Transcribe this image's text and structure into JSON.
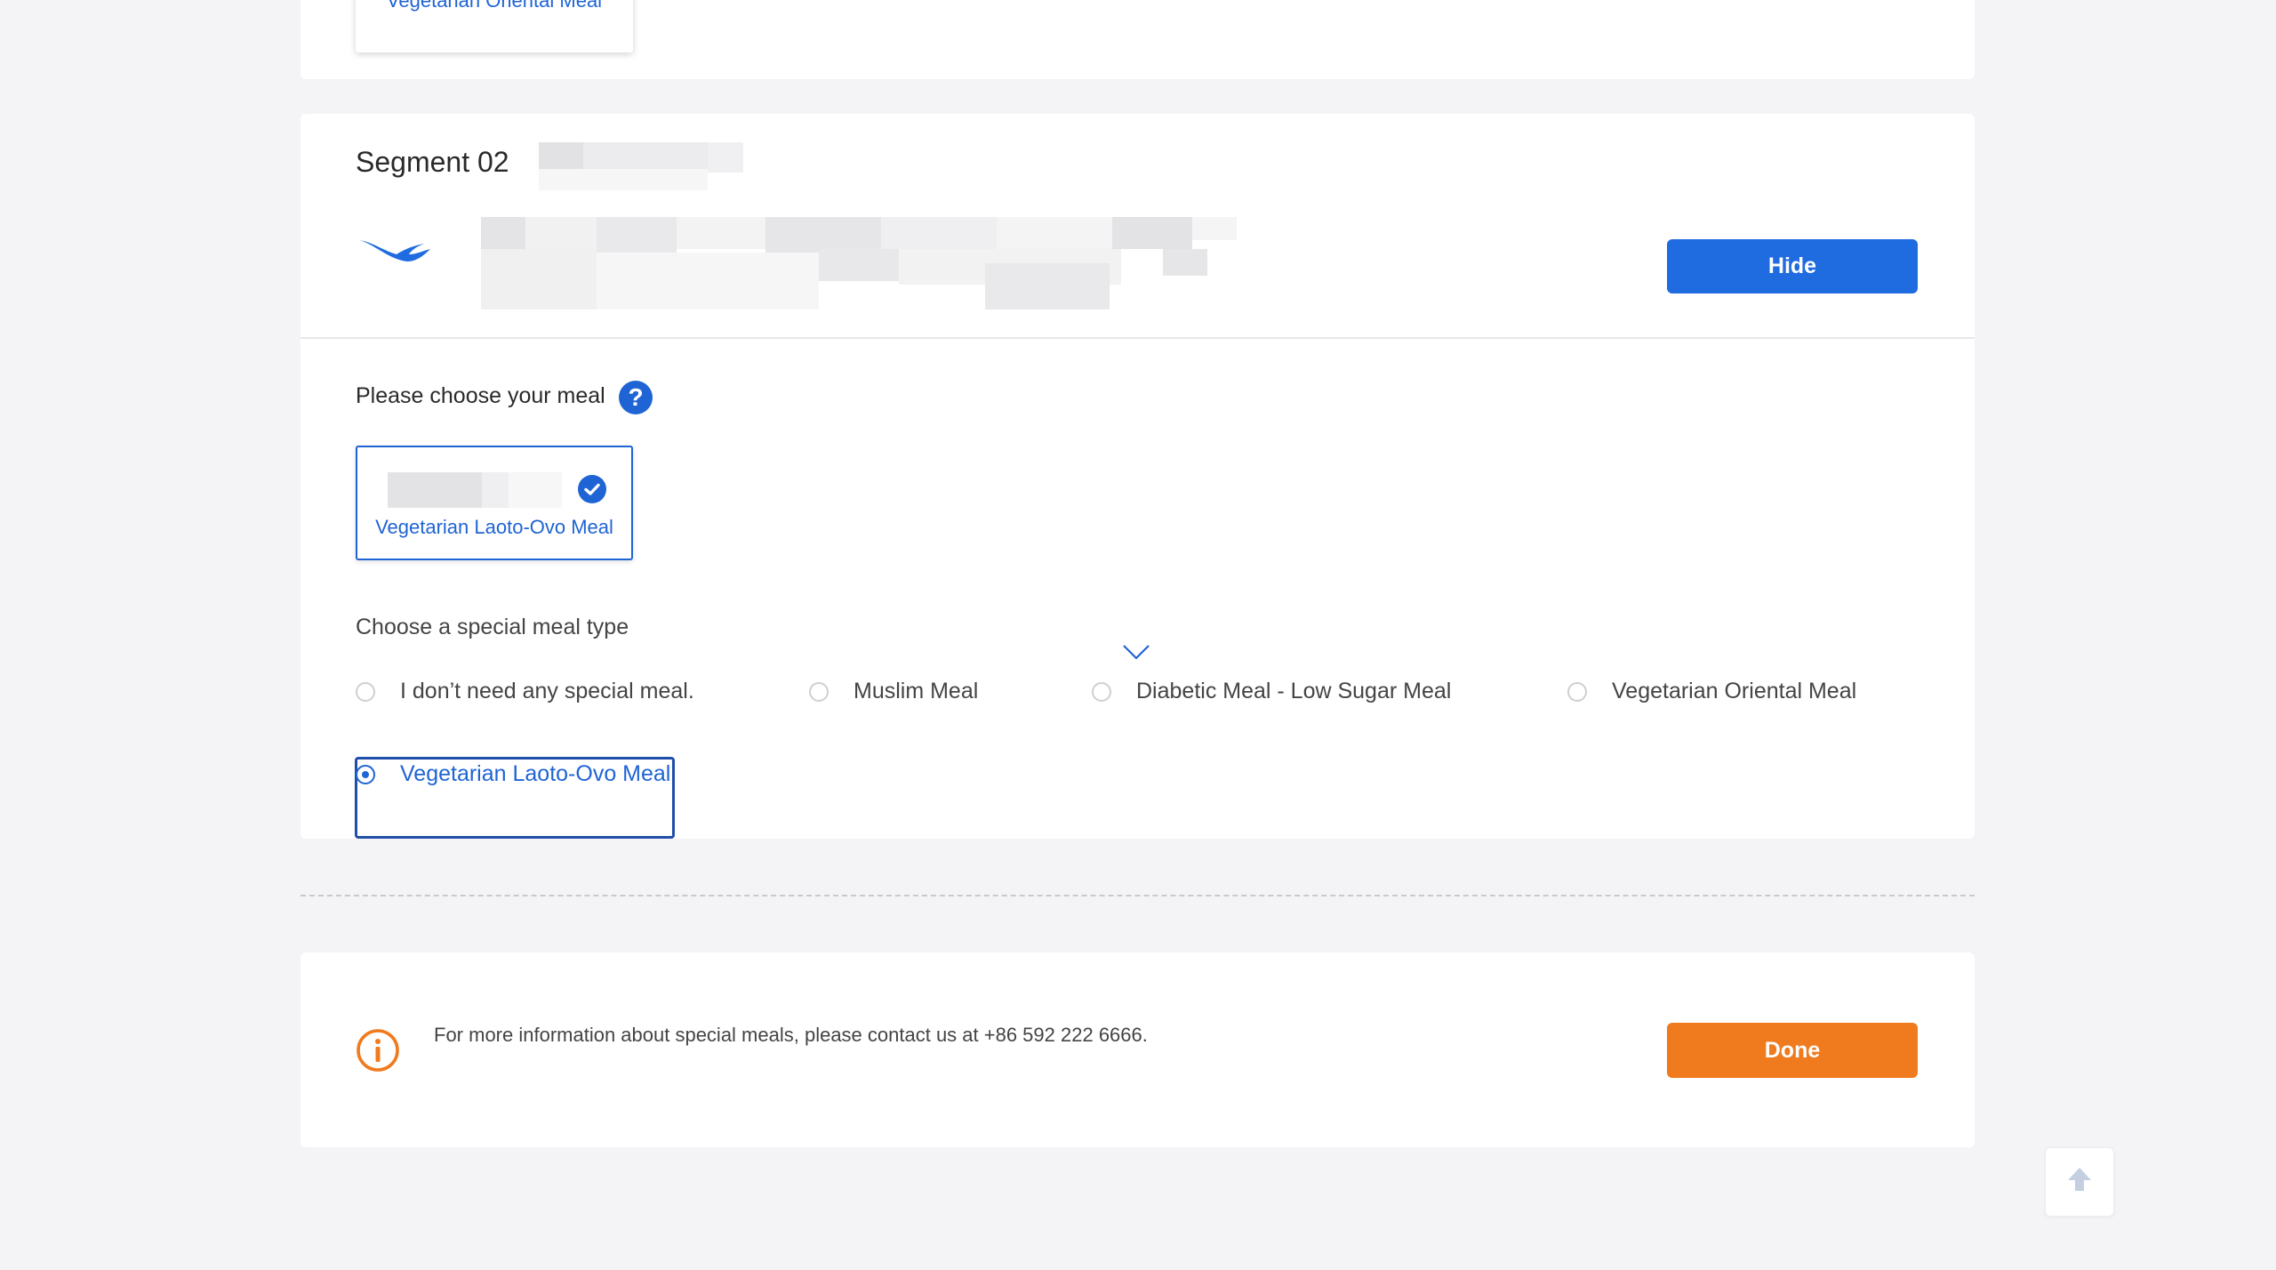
{
  "prev_segment": {
    "selected_meal_label": "Vegetarian Oriental Meal"
  },
  "segment": {
    "title": "Segment 02",
    "hide_label": "Hide",
    "meal_prompt": "Please choose your meal",
    "help_icon": "question-icon",
    "selected_meal_tile_label": "Vegetarian Laoto-Ovo Meal",
    "special_meal_prompt": "Choose a special meal type",
    "options": [
      {
        "label": "I don’t need any special meal.",
        "checked": false
      },
      {
        "label": "Muslim Meal",
        "checked": false
      },
      {
        "label": "Diabetic Meal - Low Sugar Meal",
        "checked": false
      },
      {
        "label": "Vegetarian Oriental Meal",
        "checked": false
      },
      {
        "label": "Vegetarian Laoto-Ovo Meal",
        "checked": true
      }
    ]
  },
  "footer": {
    "info_text": "For more information about special meals, please contact us at +86 592 222 6666.",
    "done_label": "Done"
  },
  "colors": {
    "primary": "#1f6be0",
    "accent": "#f07a1e",
    "background": "#f4f4f6"
  }
}
